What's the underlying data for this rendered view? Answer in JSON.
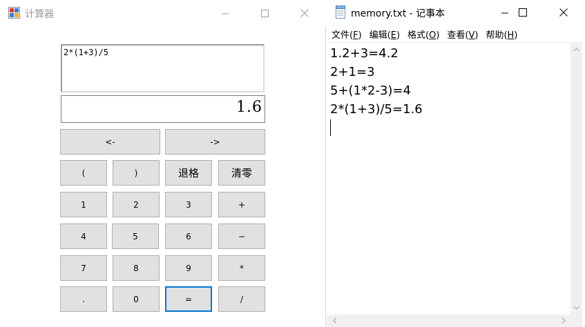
{
  "calculator": {
    "title": "计算器",
    "expression": "2*(1+3)/5",
    "result": "1.6",
    "buttons": {
      "left_arrow": "<-",
      "right_arrow": "->",
      "lparen": "(",
      "rparen": ")",
      "backspace": "退格",
      "clear": "清零",
      "d1": "1",
      "d2": "2",
      "d3": "3",
      "plus": "+",
      "d4": "4",
      "d5": "5",
      "d6": "6",
      "minus": "−",
      "d7": "7",
      "d8": "8",
      "d9": "9",
      "multiply": "*",
      "dot": ".",
      "d0": "0",
      "equals": "=",
      "divide": "/"
    }
  },
  "notepad": {
    "title": "memory.txt - 记事本",
    "menu": {
      "file": {
        "label": "文件(",
        "key": "F",
        "end": ")"
      },
      "edit": {
        "label": "编辑(",
        "key": "E",
        "end": ")"
      },
      "format": {
        "label": "格式(",
        "key": "O",
        "end": ")"
      },
      "view": {
        "label": "查看(",
        "key": "V",
        "end": ")"
      },
      "help": {
        "label": "帮助(",
        "key": "H",
        "end": ")"
      }
    },
    "lines": [
      "1.2+3=4.2",
      "2+1=3",
      "5+(1*2-3)=4",
      "2*(1+3)/5=1.6"
    ]
  },
  "colors": {
    "focus": "#0078d7",
    "button_face": "#e1e1e1",
    "button_border": "#adadad"
  }
}
